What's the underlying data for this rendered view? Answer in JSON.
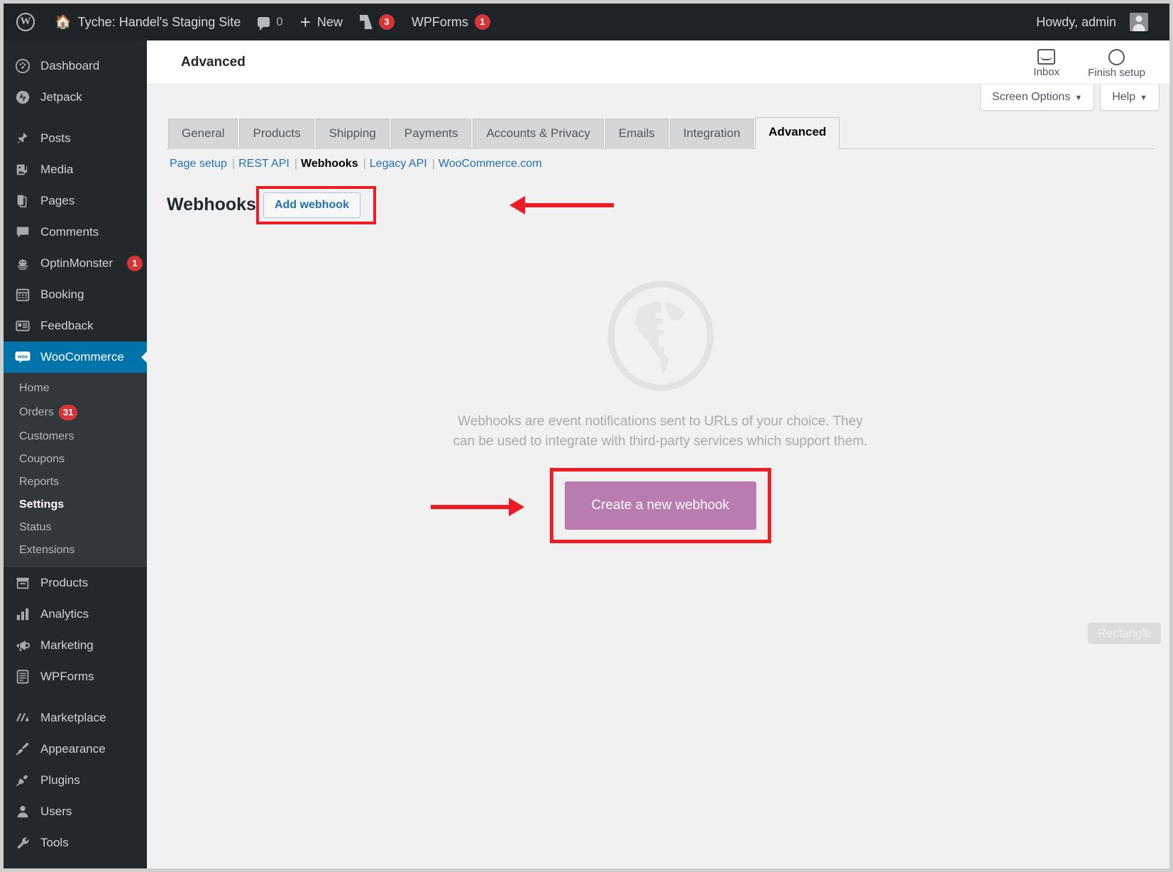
{
  "adminbar": {
    "logo_icon": "wordpress-logo-icon",
    "home_icon": "home-icon",
    "site_name": "Tyche: Handel's Staging Site",
    "comments_icon": "comment-bubble-icon",
    "comments_count": "0",
    "new_icon": "plus-icon",
    "new_label": "New",
    "yoast_icon": "yoast-icon",
    "yoast_count": "3",
    "wpforms_label": "WPForms",
    "wpforms_count": "1",
    "howdy": "Howdy, admin",
    "avatar_icon": "avatar-icon"
  },
  "sidebar": {
    "items": [
      {
        "label": "Dashboard",
        "icon": "dashboard-icon",
        "badge": ""
      },
      {
        "label": "Jetpack",
        "icon": "jetpack-icon",
        "badge": ""
      },
      {
        "label": "Posts",
        "icon": "pin-icon",
        "badge": ""
      },
      {
        "label": "Media",
        "icon": "media-icon",
        "badge": ""
      },
      {
        "label": "Pages",
        "icon": "pages-icon",
        "badge": ""
      },
      {
        "label": "Comments",
        "icon": "comment-bubble-icon",
        "badge": ""
      },
      {
        "label": "OptinMonster",
        "icon": "optinmonster-icon",
        "badge": "1"
      },
      {
        "label": "Booking",
        "icon": "calendar-icon",
        "badge": ""
      },
      {
        "label": "Feedback",
        "icon": "feedback-icon",
        "badge": ""
      },
      {
        "label": "WooCommerce",
        "icon": "woocommerce-icon",
        "badge": "",
        "current": true
      },
      {
        "label": "Products",
        "icon": "products-icon",
        "badge": ""
      },
      {
        "label": "Analytics",
        "icon": "analytics-icon",
        "badge": ""
      },
      {
        "label": "Marketing",
        "icon": "megaphone-icon",
        "badge": ""
      },
      {
        "label": "WPForms",
        "icon": "wpforms-icon",
        "badge": ""
      },
      {
        "label": "Marketplace",
        "icon": "marketplace-icon",
        "badge": ""
      },
      {
        "label": "Appearance",
        "icon": "paintbrush-icon",
        "badge": ""
      },
      {
        "label": "Plugins",
        "icon": "plug-icon",
        "badge": ""
      },
      {
        "label": "Users",
        "icon": "user-icon",
        "badge": ""
      },
      {
        "label": "Tools",
        "icon": "wrench-icon",
        "badge": ""
      }
    ],
    "woo_submenu": [
      {
        "label": "Home",
        "badge": ""
      },
      {
        "label": "Orders",
        "badge": "31"
      },
      {
        "label": "Customers",
        "badge": ""
      },
      {
        "label": "Coupons",
        "badge": ""
      },
      {
        "label": "Reports",
        "badge": ""
      },
      {
        "label": "Settings",
        "badge": "",
        "active": true
      },
      {
        "label": "Status",
        "badge": ""
      },
      {
        "label": "Extensions",
        "badge": ""
      }
    ]
  },
  "header": {
    "title": "Advanced",
    "inbox_label": "Inbox",
    "inbox_icon": "inbox-icon",
    "finish_setup_label": "Finish setup",
    "finish_setup_icon": "progress-circle-icon",
    "screen_options": "Screen Options",
    "help": "Help",
    "caret": "▼"
  },
  "tabs": [
    {
      "label": "General"
    },
    {
      "label": "Products"
    },
    {
      "label": "Shipping"
    },
    {
      "label": "Payments"
    },
    {
      "label": "Accounts & Privacy"
    },
    {
      "label": "Emails"
    },
    {
      "label": "Integration"
    },
    {
      "label": "Advanced",
      "active": true
    }
  ],
  "subnav": {
    "items": [
      {
        "label": "Page setup",
        "current": false
      },
      {
        "label": "REST API",
        "current": false
      },
      {
        "label": "Webhooks",
        "current": true
      },
      {
        "label": "Legacy API",
        "current": false
      },
      {
        "label": "WooCommerce.com",
        "current": false
      }
    ],
    "separator": "|"
  },
  "webhooks": {
    "heading": "Webhooks",
    "add_button": "Add webhook",
    "empty_icon": "globe-icon",
    "empty_line1": "Webhooks are event notifications sent to URLs of your choice. They",
    "empty_line2": "can be used to integrate with third-party services which support them.",
    "cta_label": "Create a new webhook"
  },
  "annotations": {
    "rect_badge": "Rectangle",
    "highlight_color": "#ed1c24"
  }
}
